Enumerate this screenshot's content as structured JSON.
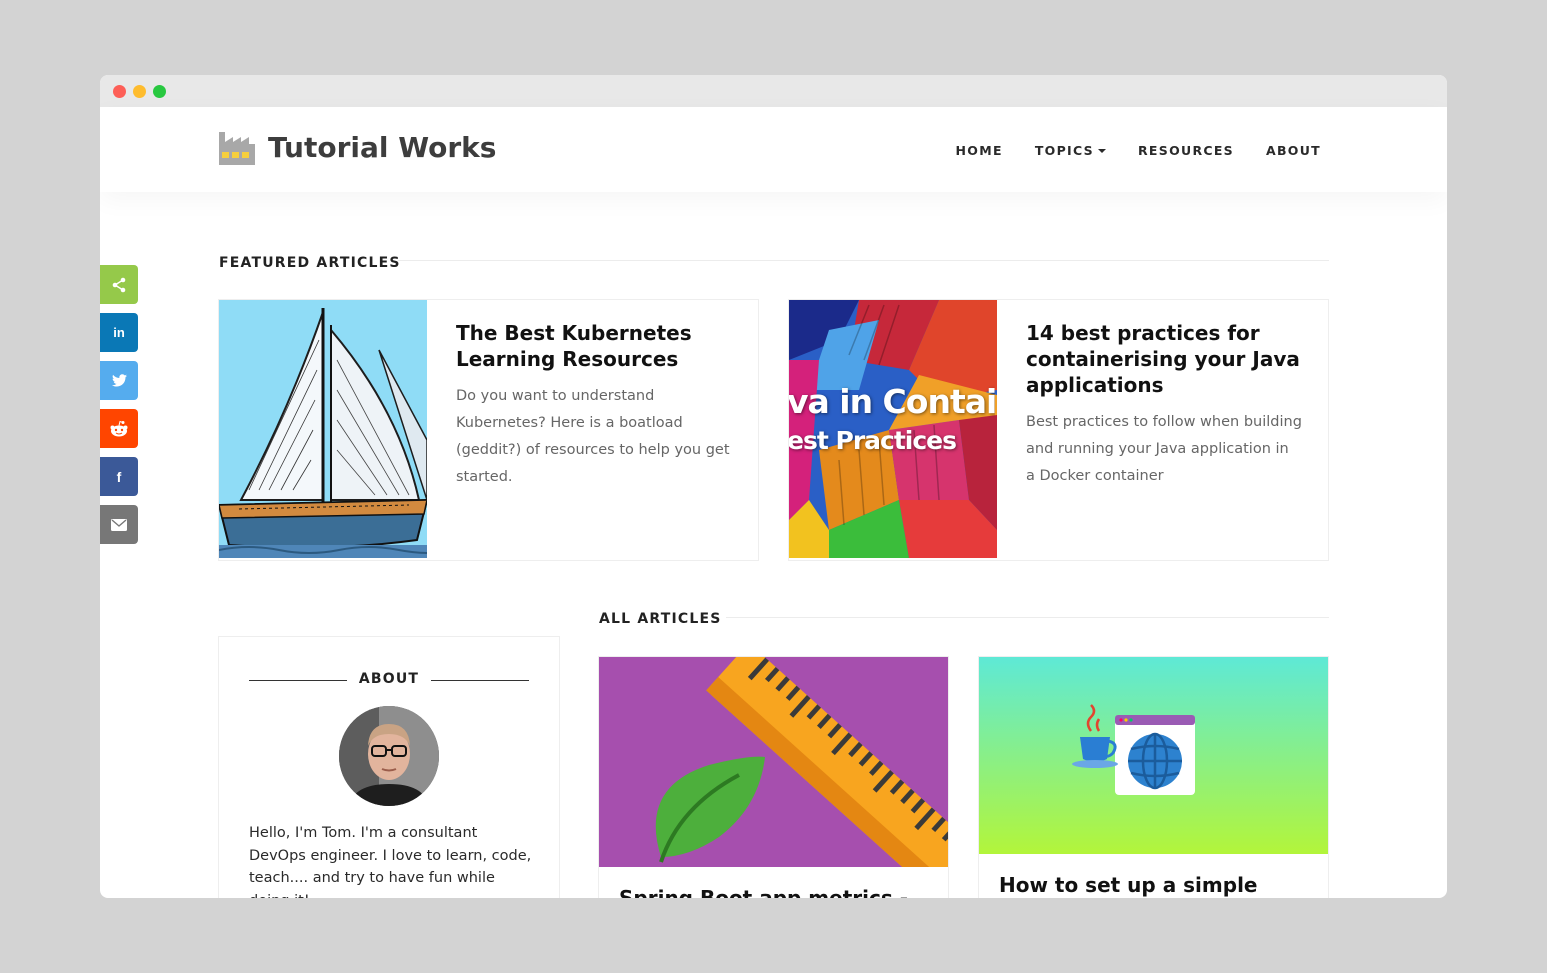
{
  "site": {
    "logo_text": "Tutorial Works"
  },
  "nav": {
    "items": [
      {
        "label": "HOME"
      },
      {
        "label": "TOPICS"
      },
      {
        "label": "RESOURCES"
      },
      {
        "label": "ABOUT"
      }
    ]
  },
  "share": {
    "items": [
      "share-icon",
      "linkedin-icon",
      "twitter-icon",
      "reddit-icon",
      "facebook-icon",
      "email-icon"
    ],
    "linkedin_glyph": "in",
    "facebook_glyph": "f"
  },
  "featured": {
    "heading": "FEATURED ARTICLES",
    "articles": [
      {
        "title": "The Best Kubernetes Learning Resources",
        "description": "Do you want to understand Kubernetes? Here is a boatload (geddit?) of resources to help you get started."
      },
      {
        "title": "14 best practices for containerising your Java applications",
        "description": "Best practices to follow when building and running your Java application in a Docker container",
        "image_text_line1": "va in Contai",
        "image_text_line2": "est Practices"
      }
    ]
  },
  "about": {
    "heading": "ABOUT",
    "text": "Hello, I'm Tom. I'm a consultant DevOps engineer. I love to learn, code, teach.... and try to have fun while doing it!"
  },
  "all_articles": {
    "heading": "ALL ARTICLES",
    "articles": [
      {
        "title": "Spring Boot app metrics - with"
      },
      {
        "title": "How to set up a simple Java"
      }
    ]
  },
  "colors": {
    "share_green": "#95c94a",
    "linkedin": "#0a78b6",
    "twitter": "#55acee",
    "reddit": "#ff4500",
    "facebook": "#3b5998",
    "email": "#777777"
  }
}
